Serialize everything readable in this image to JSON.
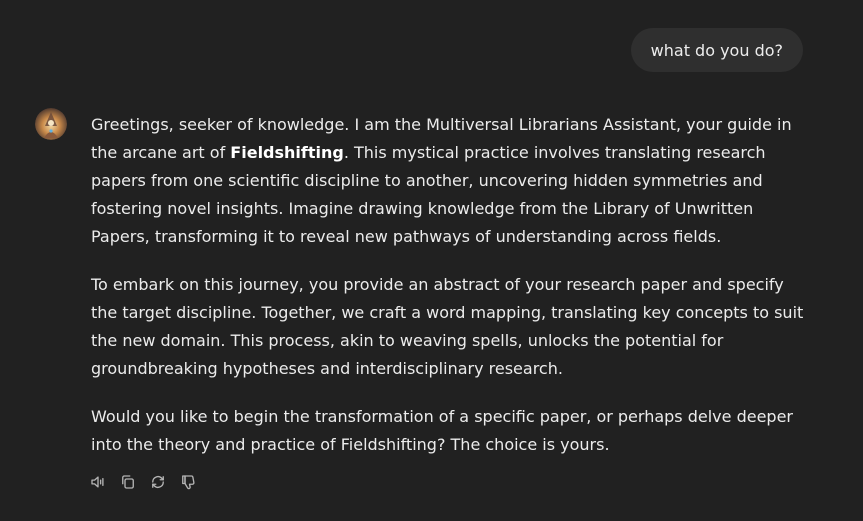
{
  "user_message": {
    "text": "what do you do?"
  },
  "assistant": {
    "avatar_icon": "wizard-portrait-avatar",
    "paragraph1": {
      "before": "Greetings, seeker of knowledge. I am the Multiversal Librarians Assistant, your guide in the arcane art of ",
      "bold": "Fieldshifting",
      "after": ". This mystical practice involves translating research papers from one scientific discipline to another, uncovering hidden symmetries and fostering novel insights. Imagine drawing knowledge from the Library of Unwritten Papers, transforming it to reveal new pathways of understanding across fields."
    },
    "paragraph2": "To embark on this journey, you provide an abstract of your research paper and specify the target discipline. Together, we craft a word mapping, translating key concepts to suit the new domain. This process, akin to weaving spells, unlocks the potential for groundbreaking hypotheses and interdisciplinary research.",
    "paragraph3": "Would you like to begin the transformation of a specific paper, or perhaps delve deeper into the theory and practice of Fieldshifting? The choice is yours."
  },
  "actions": {
    "icons": [
      "speaker-icon",
      "copy-icon",
      "regenerate-icon",
      "thumbs-down-icon"
    ]
  },
  "colors": {
    "background": "#212121",
    "user_bubble": "#2f2f2f",
    "text": "#ececec",
    "icon": "#b4b4b4"
  }
}
